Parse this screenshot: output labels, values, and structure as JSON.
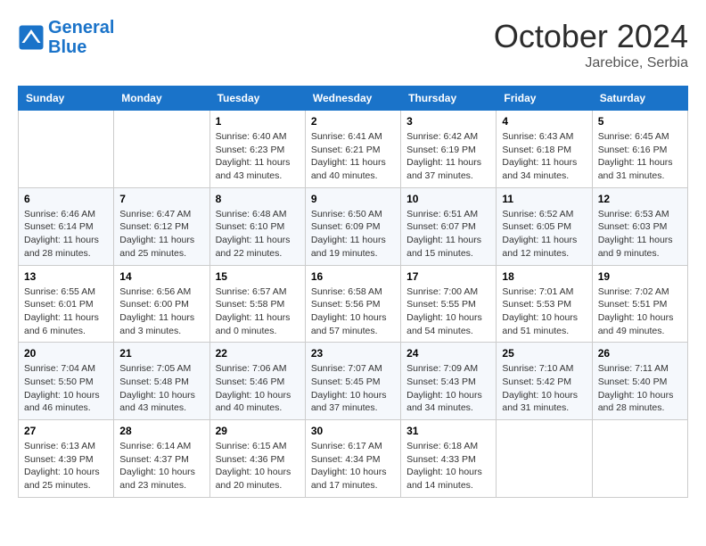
{
  "header": {
    "logo_line1": "General",
    "logo_line2": "Blue",
    "month": "October 2024",
    "location": "Jarebice, Serbia"
  },
  "weekdays": [
    "Sunday",
    "Monday",
    "Tuesday",
    "Wednesday",
    "Thursday",
    "Friday",
    "Saturday"
  ],
  "weeks": [
    [
      {
        "day": "",
        "info": ""
      },
      {
        "day": "",
        "info": ""
      },
      {
        "day": "1",
        "info": "Sunrise: 6:40 AM\nSunset: 6:23 PM\nDaylight: 11 hours and 43 minutes."
      },
      {
        "day": "2",
        "info": "Sunrise: 6:41 AM\nSunset: 6:21 PM\nDaylight: 11 hours and 40 minutes."
      },
      {
        "day": "3",
        "info": "Sunrise: 6:42 AM\nSunset: 6:19 PM\nDaylight: 11 hours and 37 minutes."
      },
      {
        "day": "4",
        "info": "Sunrise: 6:43 AM\nSunset: 6:18 PM\nDaylight: 11 hours and 34 minutes."
      },
      {
        "day": "5",
        "info": "Sunrise: 6:45 AM\nSunset: 6:16 PM\nDaylight: 11 hours and 31 minutes."
      }
    ],
    [
      {
        "day": "6",
        "info": "Sunrise: 6:46 AM\nSunset: 6:14 PM\nDaylight: 11 hours and 28 minutes."
      },
      {
        "day": "7",
        "info": "Sunrise: 6:47 AM\nSunset: 6:12 PM\nDaylight: 11 hours and 25 minutes."
      },
      {
        "day": "8",
        "info": "Sunrise: 6:48 AM\nSunset: 6:10 PM\nDaylight: 11 hours and 22 minutes."
      },
      {
        "day": "9",
        "info": "Sunrise: 6:50 AM\nSunset: 6:09 PM\nDaylight: 11 hours and 19 minutes."
      },
      {
        "day": "10",
        "info": "Sunrise: 6:51 AM\nSunset: 6:07 PM\nDaylight: 11 hours and 15 minutes."
      },
      {
        "day": "11",
        "info": "Sunrise: 6:52 AM\nSunset: 6:05 PM\nDaylight: 11 hours and 12 minutes."
      },
      {
        "day": "12",
        "info": "Sunrise: 6:53 AM\nSunset: 6:03 PM\nDaylight: 11 hours and 9 minutes."
      }
    ],
    [
      {
        "day": "13",
        "info": "Sunrise: 6:55 AM\nSunset: 6:01 PM\nDaylight: 11 hours and 6 minutes."
      },
      {
        "day": "14",
        "info": "Sunrise: 6:56 AM\nSunset: 6:00 PM\nDaylight: 11 hours and 3 minutes."
      },
      {
        "day": "15",
        "info": "Sunrise: 6:57 AM\nSunset: 5:58 PM\nDaylight: 11 hours and 0 minutes."
      },
      {
        "day": "16",
        "info": "Sunrise: 6:58 AM\nSunset: 5:56 PM\nDaylight: 10 hours and 57 minutes."
      },
      {
        "day": "17",
        "info": "Sunrise: 7:00 AM\nSunset: 5:55 PM\nDaylight: 10 hours and 54 minutes."
      },
      {
        "day": "18",
        "info": "Sunrise: 7:01 AM\nSunset: 5:53 PM\nDaylight: 10 hours and 51 minutes."
      },
      {
        "day": "19",
        "info": "Sunrise: 7:02 AM\nSunset: 5:51 PM\nDaylight: 10 hours and 49 minutes."
      }
    ],
    [
      {
        "day": "20",
        "info": "Sunrise: 7:04 AM\nSunset: 5:50 PM\nDaylight: 10 hours and 46 minutes."
      },
      {
        "day": "21",
        "info": "Sunrise: 7:05 AM\nSunset: 5:48 PM\nDaylight: 10 hours and 43 minutes."
      },
      {
        "day": "22",
        "info": "Sunrise: 7:06 AM\nSunset: 5:46 PM\nDaylight: 10 hours and 40 minutes."
      },
      {
        "day": "23",
        "info": "Sunrise: 7:07 AM\nSunset: 5:45 PM\nDaylight: 10 hours and 37 minutes."
      },
      {
        "day": "24",
        "info": "Sunrise: 7:09 AM\nSunset: 5:43 PM\nDaylight: 10 hours and 34 minutes."
      },
      {
        "day": "25",
        "info": "Sunrise: 7:10 AM\nSunset: 5:42 PM\nDaylight: 10 hours and 31 minutes."
      },
      {
        "day": "26",
        "info": "Sunrise: 7:11 AM\nSunset: 5:40 PM\nDaylight: 10 hours and 28 minutes."
      }
    ],
    [
      {
        "day": "27",
        "info": "Sunrise: 6:13 AM\nSunset: 4:39 PM\nDaylight: 10 hours and 25 minutes."
      },
      {
        "day": "28",
        "info": "Sunrise: 6:14 AM\nSunset: 4:37 PM\nDaylight: 10 hours and 23 minutes."
      },
      {
        "day": "29",
        "info": "Sunrise: 6:15 AM\nSunset: 4:36 PM\nDaylight: 10 hours and 20 minutes."
      },
      {
        "day": "30",
        "info": "Sunrise: 6:17 AM\nSunset: 4:34 PM\nDaylight: 10 hours and 17 minutes."
      },
      {
        "day": "31",
        "info": "Sunrise: 6:18 AM\nSunset: 4:33 PM\nDaylight: 10 hours and 14 minutes."
      },
      {
        "day": "",
        "info": ""
      },
      {
        "day": "",
        "info": ""
      }
    ]
  ]
}
